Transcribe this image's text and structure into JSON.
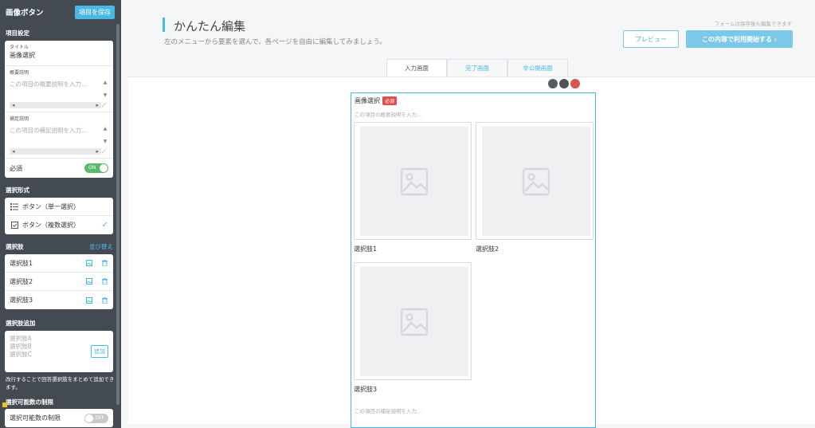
{
  "sidebar": {
    "title": "画像ボタン",
    "save_label": "項目を保存",
    "item_settings_label": "項目設定",
    "title_field": {
      "label": "タイトル",
      "value": "画像選択"
    },
    "summary_field": {
      "label": "概要説明",
      "placeholder": "この項目の概要説明を入力..."
    },
    "supplement_field": {
      "label": "補足説明",
      "placeholder": "この項目の補足説明を入力..."
    },
    "required": {
      "label": "必須",
      "toggle": "ON"
    },
    "selection_type_label": "選択形式",
    "selection_types": [
      {
        "label": "ボタン（単一選択）",
        "icon": "list-icon",
        "selected": false
      },
      {
        "label": "ボタン（複数選択）",
        "icon": "checkbox-icon",
        "selected": true
      }
    ],
    "options_label": "選択肢",
    "reorder_label": "並び替え",
    "options": [
      {
        "label": "選択肢1"
      },
      {
        "label": "選択肢2"
      },
      {
        "label": "選択肢3"
      }
    ],
    "add_options_label": "選択肢追加",
    "add_placeholder_lines": [
      "選択肢A",
      "選択肢B",
      "選択肢C"
    ],
    "add_button": "追加",
    "add_note": "改行することで回答選択肢をまとめて追加できます。",
    "limit_label": "選択可能数の制限",
    "limit_row": {
      "label": "選択可能数の制限",
      "toggle": "OFF"
    }
  },
  "main": {
    "title": "かんたん編集",
    "subtitle": "左のメニューから要素を選んで、各ページを自由に編集してみましょう。",
    "autosave": "フォームは保存後も編集できます",
    "preview_button": "プレビュー",
    "start_button": "この内容で利用開始する ›",
    "tabs": [
      "入力画面",
      "完了画面",
      "非公開画面"
    ],
    "active_tab": 0,
    "dot_colors": [
      "#555c63",
      "#4d5358",
      "#d9534f"
    ],
    "question": {
      "title": "画像選択",
      "required_badge": "必須",
      "description_placeholder": "この項目の概要説明を入力...",
      "choices": [
        "選択肢1",
        "選択肢2",
        "選択肢3"
      ],
      "supplement_placeholder": "この項目の補足説明を入力..."
    }
  },
  "colors": {
    "sidebar_bg": "#434a52",
    "accent": "#49b9e4",
    "toggle_on": "#5aba6a",
    "required_badge": "#e04f4f"
  }
}
